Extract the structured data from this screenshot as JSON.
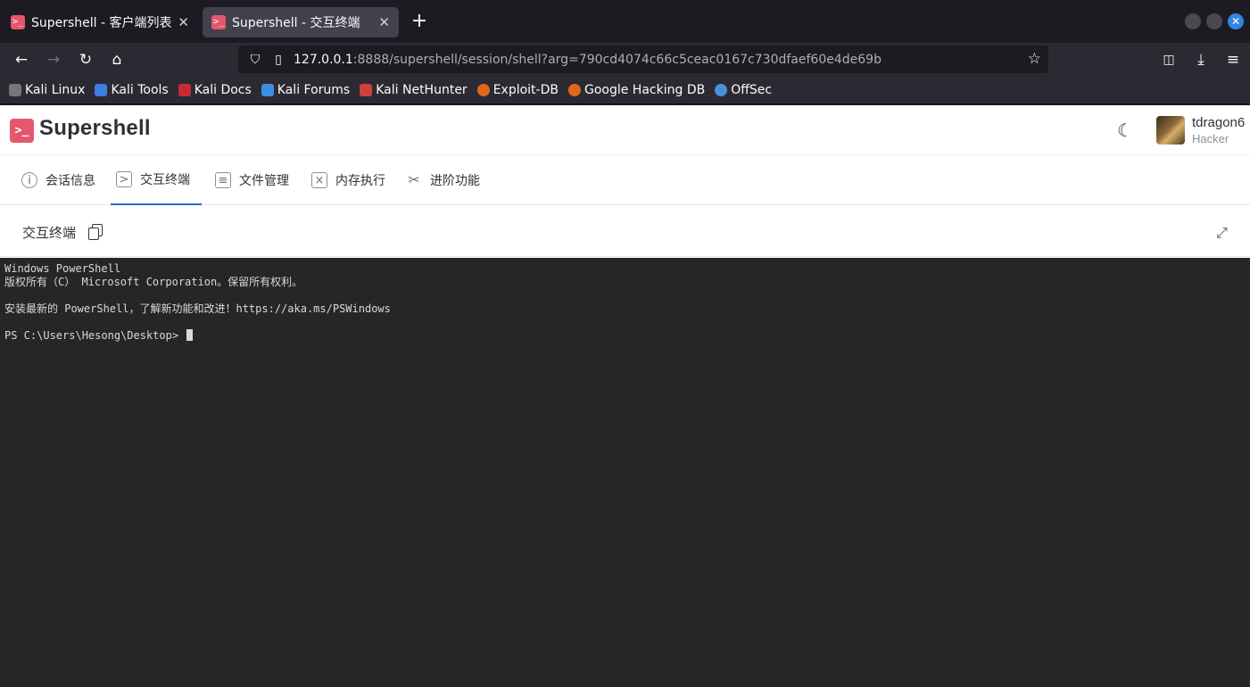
{
  "browser": {
    "tabs": [
      {
        "title": "Supershell - 客户端列表",
        "close": "✕",
        "favicon": ">_"
      },
      {
        "title": "Supershell - 交互终端",
        "close": "✕",
        "favicon": ">_"
      }
    ],
    "new_tab_icon": "+",
    "window_close": "✕",
    "nav": {
      "back_icon": "←",
      "forward_icon": "→",
      "reload_icon": "↻",
      "home_icon": "⌂"
    },
    "url": {
      "host": "127.0.0.1",
      "path": ":8888/supershell/session/shell?arg=790cd4074c66c5ceac0167c730dfaef60e4de69b"
    },
    "bookmarks": [
      {
        "label": "Kali Linux",
        "color": "#2b2a33"
      },
      {
        "label": "Kali Tools",
        "color": "#3d7de0"
      },
      {
        "label": "Kali Docs",
        "color": "#c72b32"
      },
      {
        "label": "Kali Forums",
        "color": "#3b8fe2"
      },
      {
        "label": "Kali NetHunter",
        "color": "#d33e3e"
      },
      {
        "label": "Exploit-DB",
        "color": "#e0661e"
      },
      {
        "label": "Google Hacking DB",
        "color": "#e0661e"
      },
      {
        "label": "OffSec",
        "color": "#4a90d9"
      }
    ]
  },
  "app": {
    "brand": "Supershell",
    "logo_glyph": ">_",
    "user": {
      "name": "tdragon6",
      "role": "Hacker"
    },
    "tabs": [
      {
        "label": "会话信息",
        "icon": "i"
      },
      {
        "label": "交互终端",
        "icon": ">"
      },
      {
        "label": "文件管理",
        "icon": "≡"
      },
      {
        "label": "内存执行",
        "icon": "×"
      },
      {
        "label": "进阶功能",
        "icon": "✂"
      }
    ],
    "panel_title": "交互终端",
    "expand_icon": "⤢"
  },
  "terminal": {
    "lines": [
      "Windows PowerShell",
      "版权所有（C） Microsoft Corporation。保留所有权利。",
      "",
      "安装最新的 PowerShell，了解新功能和改进！https://aka.ms/PSWindows",
      "",
      "PS C:\\Users\\Hesong\\Desktop> "
    ]
  },
  "colors": {
    "accent": "#e5576d",
    "tab_active_underline": "#1f6fd0",
    "terminal_bg": "#262626"
  }
}
